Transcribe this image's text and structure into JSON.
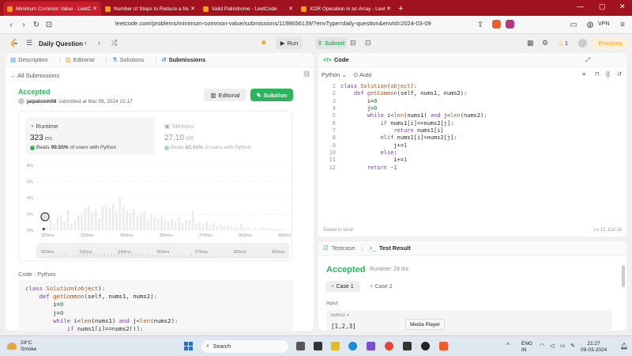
{
  "browser": {
    "tabs": [
      {
        "title": "Minimum Common Value - LeetC",
        "active": true
      },
      {
        "title": "Number of Steps to Reduce a Numb",
        "active": false
      },
      {
        "title": "Valid Palindrome - LeetCode",
        "active": false
      },
      {
        "title": "XOR Operation in an Array - LeetCo",
        "active": false
      }
    ],
    "url": "leetcode.com/problems/minimum-common-value/submissions/1198656139/?envType=daily-question&envId=2024-03-09",
    "vpn_label": "VPN"
  },
  "header": {
    "problem_list_label": "Daily Question",
    "run_label": "Run",
    "submit_label": "Submit",
    "streak_count": "1",
    "premium_label": "Premium"
  },
  "left_tabs": [
    "Description",
    "Editorial",
    "Solutions",
    "Submissions"
  ],
  "submission": {
    "back_label": "All Submissions",
    "status": "Accepted",
    "submitter": "jaipalsinh08",
    "submitted_at": "submitted at Mar 09, 2024 21:17",
    "editorial_label": "Editorial",
    "solution_label": "Solution",
    "runtime": {
      "title": "Runtime",
      "value": "323",
      "unit": "ms",
      "beats_prefix": "Beats",
      "beats_pct": "99.55%",
      "beats_suffix": "of users with Python"
    },
    "memory": {
      "title": "Memory",
      "value": "27.10",
      "unit": "MB",
      "beats_prefix": "Beats",
      "beats_pct": "82.41%",
      "beats_suffix": "of users with Python"
    }
  },
  "chart_data": {
    "type": "bar",
    "ylabel": "",
    "yticks": [
      "8%",
      "6%",
      "4%",
      "2%",
      "0%"
    ],
    "ylim": [
      0,
      8
    ],
    "x_tick_labels": [
      "320ms",
      "339ms",
      "349ms",
      "359ms",
      "370ms",
      "383ms",
      "462ms"
    ],
    "values": [
      0.3,
      0.6,
      1.4,
      0.8,
      1.6,
      1.9,
      1.1,
      2.5,
      0.8,
      1.3,
      1.8,
      2.0,
      2.8,
      3.1,
      2.2,
      2.6,
      1.5,
      2.9,
      3.0,
      2.7,
      3.2,
      2.3,
      4.0,
      3.0,
      2.5,
      2.1,
      2.6,
      1.8,
      2.0,
      2.4,
      1.3,
      2.0,
      1.6,
      1.5,
      1.7,
      1.3,
      1.0,
      1.4,
      1.1,
      1.6,
      0.9,
      1.3,
      1.2,
      2.5,
      0.8,
      1.0,
      0.7,
      1.1,
      0.6,
      0.9,
      0.5,
      0.7,
      0.4,
      0.6,
      0.5,
      0.4,
      0.3,
      0.8,
      0.3,
      0.4,
      0.2,
      0.3,
      0.2,
      0.4,
      0.2,
      0.3,
      0.2,
      0.2,
      0.1,
      0.2
    ],
    "highlight_index": 0
  },
  "mini_chart_labels": [
    "320ms",
    "339ms",
    "349ms",
    "359ms",
    "370ms",
    "383ms",
    "462ms"
  ],
  "code_section": {
    "head": "Code",
    "lang": "Python",
    "lines": [
      "class Solution(object):",
      "    def getCommon(self, nums1, nums2):",
      "        i=0",
      "        j=0",
      "        while i<len(nums1) and j<len(nums2):",
      "            if nums1[i]==nums2[j]:"
    ]
  },
  "editor": {
    "tab_label": "Code",
    "language": "Python",
    "mode": "Auto",
    "line_numbers": [
      "1",
      "2",
      "3",
      "4",
      "5",
      "6",
      "7",
      "8",
      "9",
      "10",
      "11",
      "12"
    ],
    "lines": [
      "class Solution(object):",
      "    def getCommon(self, nums1, nums2):",
      "        i=0",
      "        j=0",
      "        while i<len(nums1) and j<len(nums2):",
      "            if nums1[i]==nums2[j]:",
      "                return nums1[i]",
      "            elif nums1[i]>nums2[j]:",
      "                j+=1",
      "            else:",
      "                i+=1",
      "        return -1"
    ],
    "saved_text": "Saved to local",
    "cursor_text": "Ln 12, Col 18"
  },
  "test_panel": {
    "testcase_tab": "Testcase",
    "result_tab": "Test Result",
    "status": "Accepted",
    "runtime": "Runtime: 29 ms",
    "case1": "Case 1",
    "case2": "Case 2",
    "input_label": "Input",
    "nums_label": "nums1 =",
    "nums_value": "[1,2,3]"
  },
  "tooltip": "Media Player",
  "taskbar": {
    "temp": "24°C",
    "weather": "Smoke",
    "search_placeholder": "Search",
    "lang_top": "ENG",
    "lang_bottom": "IN",
    "time": "21:27",
    "date": "09-03-2024"
  }
}
